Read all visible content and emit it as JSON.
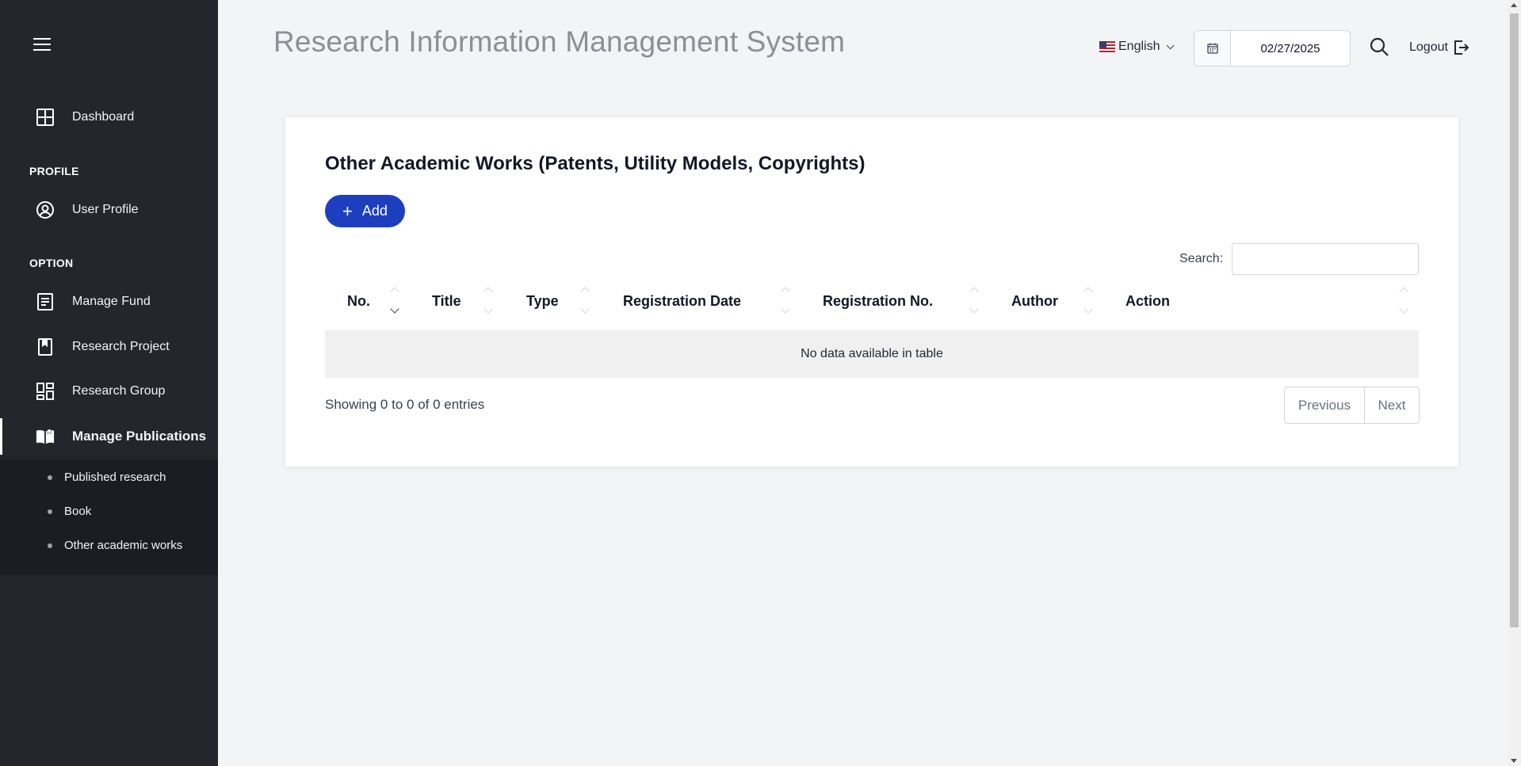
{
  "header": {
    "title": "Research Information Management System",
    "language": "English",
    "date": "02/27/2025",
    "logout_label": "Logout"
  },
  "sidebar": {
    "dashboard": "Dashboard",
    "profile_section": "PROFILE",
    "user_profile": "User Profile",
    "option_section": "OPTION",
    "items": [
      {
        "label": "Manage Fund",
        "icon": "document-list-icon"
      },
      {
        "label": "Research Project",
        "icon": "bookmark-book-icon"
      },
      {
        "label": "Research Group",
        "icon": "dashboard-grid-icon"
      },
      {
        "label": "Manage Publications",
        "icon": "open-book-icon",
        "active": true
      }
    ],
    "submenu": [
      "Published research",
      "Book",
      "Other academic works"
    ]
  },
  "main": {
    "card_title": "Other Academic Works (Patents, Utility Models, Copyrights)",
    "add_label": "Add",
    "search_label": "Search:",
    "columns": [
      "No.",
      "Title",
      "Type",
      "Registration Date",
      "Registration No.",
      "Author",
      "Action"
    ],
    "empty_text": "No data available in table",
    "info_text": "Showing 0 to 0 of 0 entries",
    "prev_label": "Previous",
    "next_label": "Next"
  }
}
